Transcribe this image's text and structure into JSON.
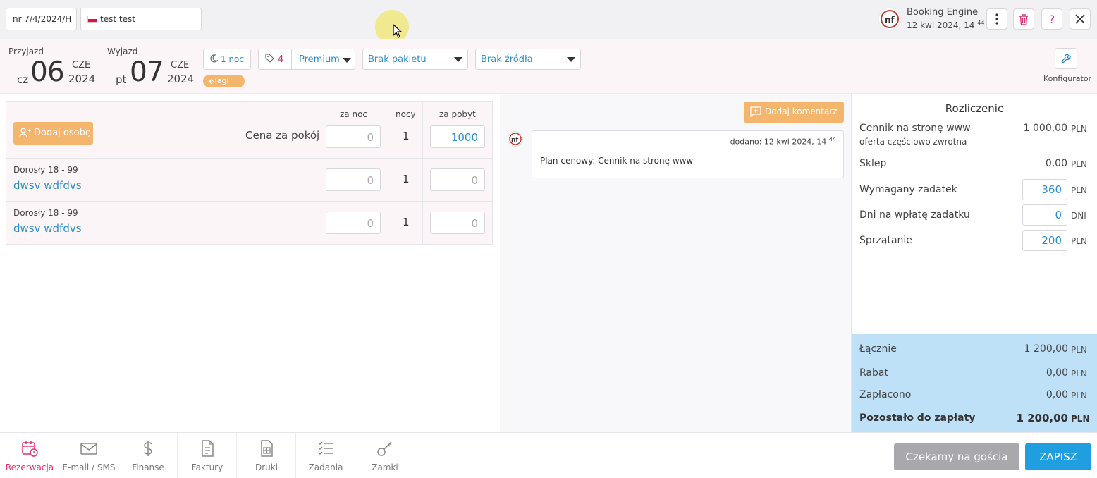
{
  "topbar": {
    "reservation_number": "nr 7/4/2024/H",
    "guest_name": "test test",
    "source_title": "Booking Engine",
    "source_date": "12 kwi 2024, 14",
    "source_minutes": "44"
  },
  "stay": {
    "arrival_label": "Przyjazd",
    "arrival_dow": "cz",
    "arrival_day": "06",
    "arrival_month": "CZE",
    "arrival_year": "2024",
    "departure_label": "Wyjazd",
    "departure_dow": "pt",
    "departure_day": "07",
    "departure_month": "CZE",
    "departure_year": "2024",
    "nights_label": "1 noc",
    "tags_label": "Tagi",
    "room_number": "4",
    "room_type": "Premium",
    "package": "Brak pakietu",
    "source": "Brak źródła",
    "configurator_label": "Konfigurator"
  },
  "price_table": {
    "col_per_night": "za noc",
    "col_nights": "nocy",
    "col_per_stay": "za pobyt",
    "add_person_label": "Dodaj osobę",
    "room_price_label": "Cena za pokój",
    "room_row": {
      "per_night": "0",
      "nights": "1",
      "per_stay": "1000"
    },
    "persons": [
      {
        "type": "Dorosły 18 - 99",
        "name": "dwsv wdfdvs",
        "per_night": "0",
        "nights": "1",
        "per_stay": "0"
      },
      {
        "type": "Dorosły 18 - 99",
        "name": "dwsv wdfdvs",
        "per_night": "0",
        "nights": "1",
        "per_stay": "0"
      }
    ]
  },
  "comments": {
    "add_label": "Dodaj komentarz",
    "items": [
      {
        "date": "dodano: 12 kwi 2024, 14",
        "date_minutes": "44",
        "text": "Plan cenowy: Cennik na stronę www"
      }
    ]
  },
  "settlement": {
    "title": "Rozliczenie",
    "pricelist_label": "Cennik na stronę www",
    "pricelist_sub": "oferta częściowo zwrotna",
    "pricelist_value": "1 000,00",
    "shop_label": "Sklep",
    "shop_value": "0,00",
    "deposit_label": "Wymagany zadatek",
    "deposit_value": "360",
    "deposit_days_label": "Dni na wpłatę zadatku",
    "deposit_days_value": "0",
    "days_unit": "DNI",
    "cleaning_label": "Sprzątanie",
    "cleaning_value": "200",
    "currency": "PLN",
    "total_label": "Łącznie",
    "total_value": "1 200,00",
    "discount_label": "Rabat",
    "discount_value": "0,00",
    "paid_label": "Zapłacono",
    "paid_value": "0,00",
    "remaining_label": "Pozostało do zapłaty",
    "remaining_value": "1 200,00"
  },
  "nav": [
    {
      "label": "Rezerwacja",
      "icon": "calendar-clock-icon"
    },
    {
      "label": "E-mail / SMS",
      "icon": "envelope-icon"
    },
    {
      "label": "Finanse",
      "icon": "dollar-icon"
    },
    {
      "label": "Faktury",
      "icon": "invoice-icon"
    },
    {
      "label": "Druki",
      "icon": "print-doc-icon"
    },
    {
      "label": "Zadania",
      "icon": "checklist-icon"
    },
    {
      "label": "Zamki",
      "icon": "key-icon"
    }
  ],
  "actions": {
    "wait_label": "Czekamy na gościa",
    "save_label": "ZAPISZ"
  },
  "colors": {
    "accent_blue": "#2a8fc9",
    "accent_pink": "#e0336e",
    "accent_orange": "#f4b56c",
    "summary_bg": "#bfe1f8",
    "save_button": "#1f9fe0"
  }
}
